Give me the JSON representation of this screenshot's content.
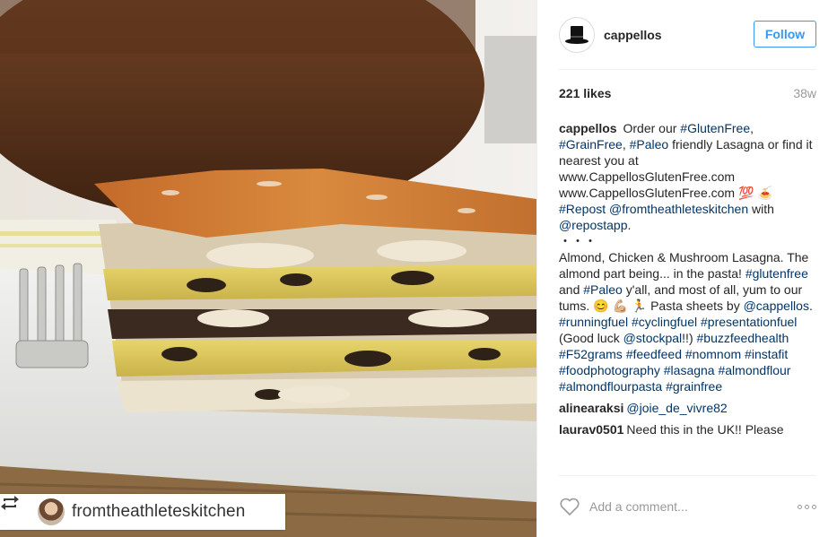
{
  "post": {
    "photo_label": "lasagna-photo",
    "repost_handle": "fromtheathleteskitchen"
  },
  "header": {
    "username": "cappellos",
    "follow_label": "Follow"
  },
  "stats": {
    "likes": "221 likes",
    "age": "38w"
  },
  "caption": {
    "author": "cappellos",
    "parts": [
      {
        "t": "Order our ",
        "tag": false
      },
      {
        "t": "#GlutenFree",
        "tag": true
      },
      {
        "t": ", ",
        "tag": false
      },
      {
        "t": "#GrainFree",
        "tag": true
      },
      {
        "t": ", ",
        "tag": false
      },
      {
        "t": "#Paleo",
        "tag": true
      },
      {
        "t": " friendly Lasagna or find it nearest you at www.CappellosGlutenFree.com www.CappellosGlutenFree.com ",
        "tag": false
      },
      {
        "t": "💯 🍝",
        "tag": false
      },
      {
        "br": true
      },
      {
        "t": "#Repost",
        "tag": true
      },
      {
        "t": " ",
        "tag": false
      },
      {
        "t": "@fromtheathleteskitchen",
        "tag": true
      },
      {
        "t": " with ",
        "tag": false
      },
      {
        "t": "@repostapp",
        "tag": true
      },
      {
        "t": ".",
        "tag": false
      },
      {
        "br": true
      },
      {
        "t": "・・・",
        "tag": false
      },
      {
        "br": true
      },
      {
        "t": "Almond, Chicken & Mushroom Lasagna. The almond part being... in the pasta! ",
        "tag": false
      },
      {
        "t": "#glutenfree",
        "tag": true
      },
      {
        "t": " and ",
        "tag": false
      },
      {
        "t": "#Paleo",
        "tag": true
      },
      {
        "t": " y'all, and most of all, yum to our tums. 😊 💪🏼 🏃 Pasta sheets by ",
        "tag": false
      },
      {
        "t": "@cappellos",
        "tag": true
      },
      {
        "t": ". ",
        "tag": false
      },
      {
        "t": "#runningfuel",
        "tag": true
      },
      {
        "t": " ",
        "tag": false
      },
      {
        "t": "#cyclingfuel",
        "tag": true
      },
      {
        "t": " ",
        "tag": false
      },
      {
        "t": "#presentationfuel",
        "tag": true
      },
      {
        "t": " (Good luck ",
        "tag": false
      },
      {
        "t": "@stockpal",
        "tag": true
      },
      {
        "t": "!!) ",
        "tag": false
      },
      {
        "t": "#buzzfeedhealth",
        "tag": true
      },
      {
        "t": " ",
        "tag": false
      },
      {
        "t": "#F52grams",
        "tag": true
      },
      {
        "t": " ",
        "tag": false
      },
      {
        "t": "#feedfeed",
        "tag": true
      },
      {
        "t": " ",
        "tag": false
      },
      {
        "t": "#nomnom",
        "tag": true
      },
      {
        "t": " ",
        "tag": false
      },
      {
        "t": "#instafit",
        "tag": true
      },
      {
        "t": " ",
        "tag": false
      },
      {
        "t": "#foodphotography",
        "tag": true
      },
      {
        "t": " ",
        "tag": false
      },
      {
        "t": "#lasagna",
        "tag": true
      },
      {
        "t": " ",
        "tag": false
      },
      {
        "t": "#almondflour",
        "tag": true
      },
      {
        "t": " ",
        "tag": false
      },
      {
        "t": "#almondflourpasta",
        "tag": true
      },
      {
        "t": " ",
        "tag": false
      },
      {
        "t": "#grainfree",
        "tag": true
      }
    ]
  },
  "comments": [
    {
      "author": "alinearaksi",
      "text": "@joie_de_vivre82",
      "tag": true
    },
    {
      "author": "laurav0501",
      "text": "Need this in the UK!! Please",
      "tag": false
    }
  ],
  "footer": {
    "add_comment_placeholder": "Add a comment...",
    "like_icon": "heart-icon",
    "more_icon": "more-options-icon"
  },
  "colors": {
    "follow_blue": "#3897f0",
    "hashtag": "#003569",
    "muted": "#999999"
  }
}
